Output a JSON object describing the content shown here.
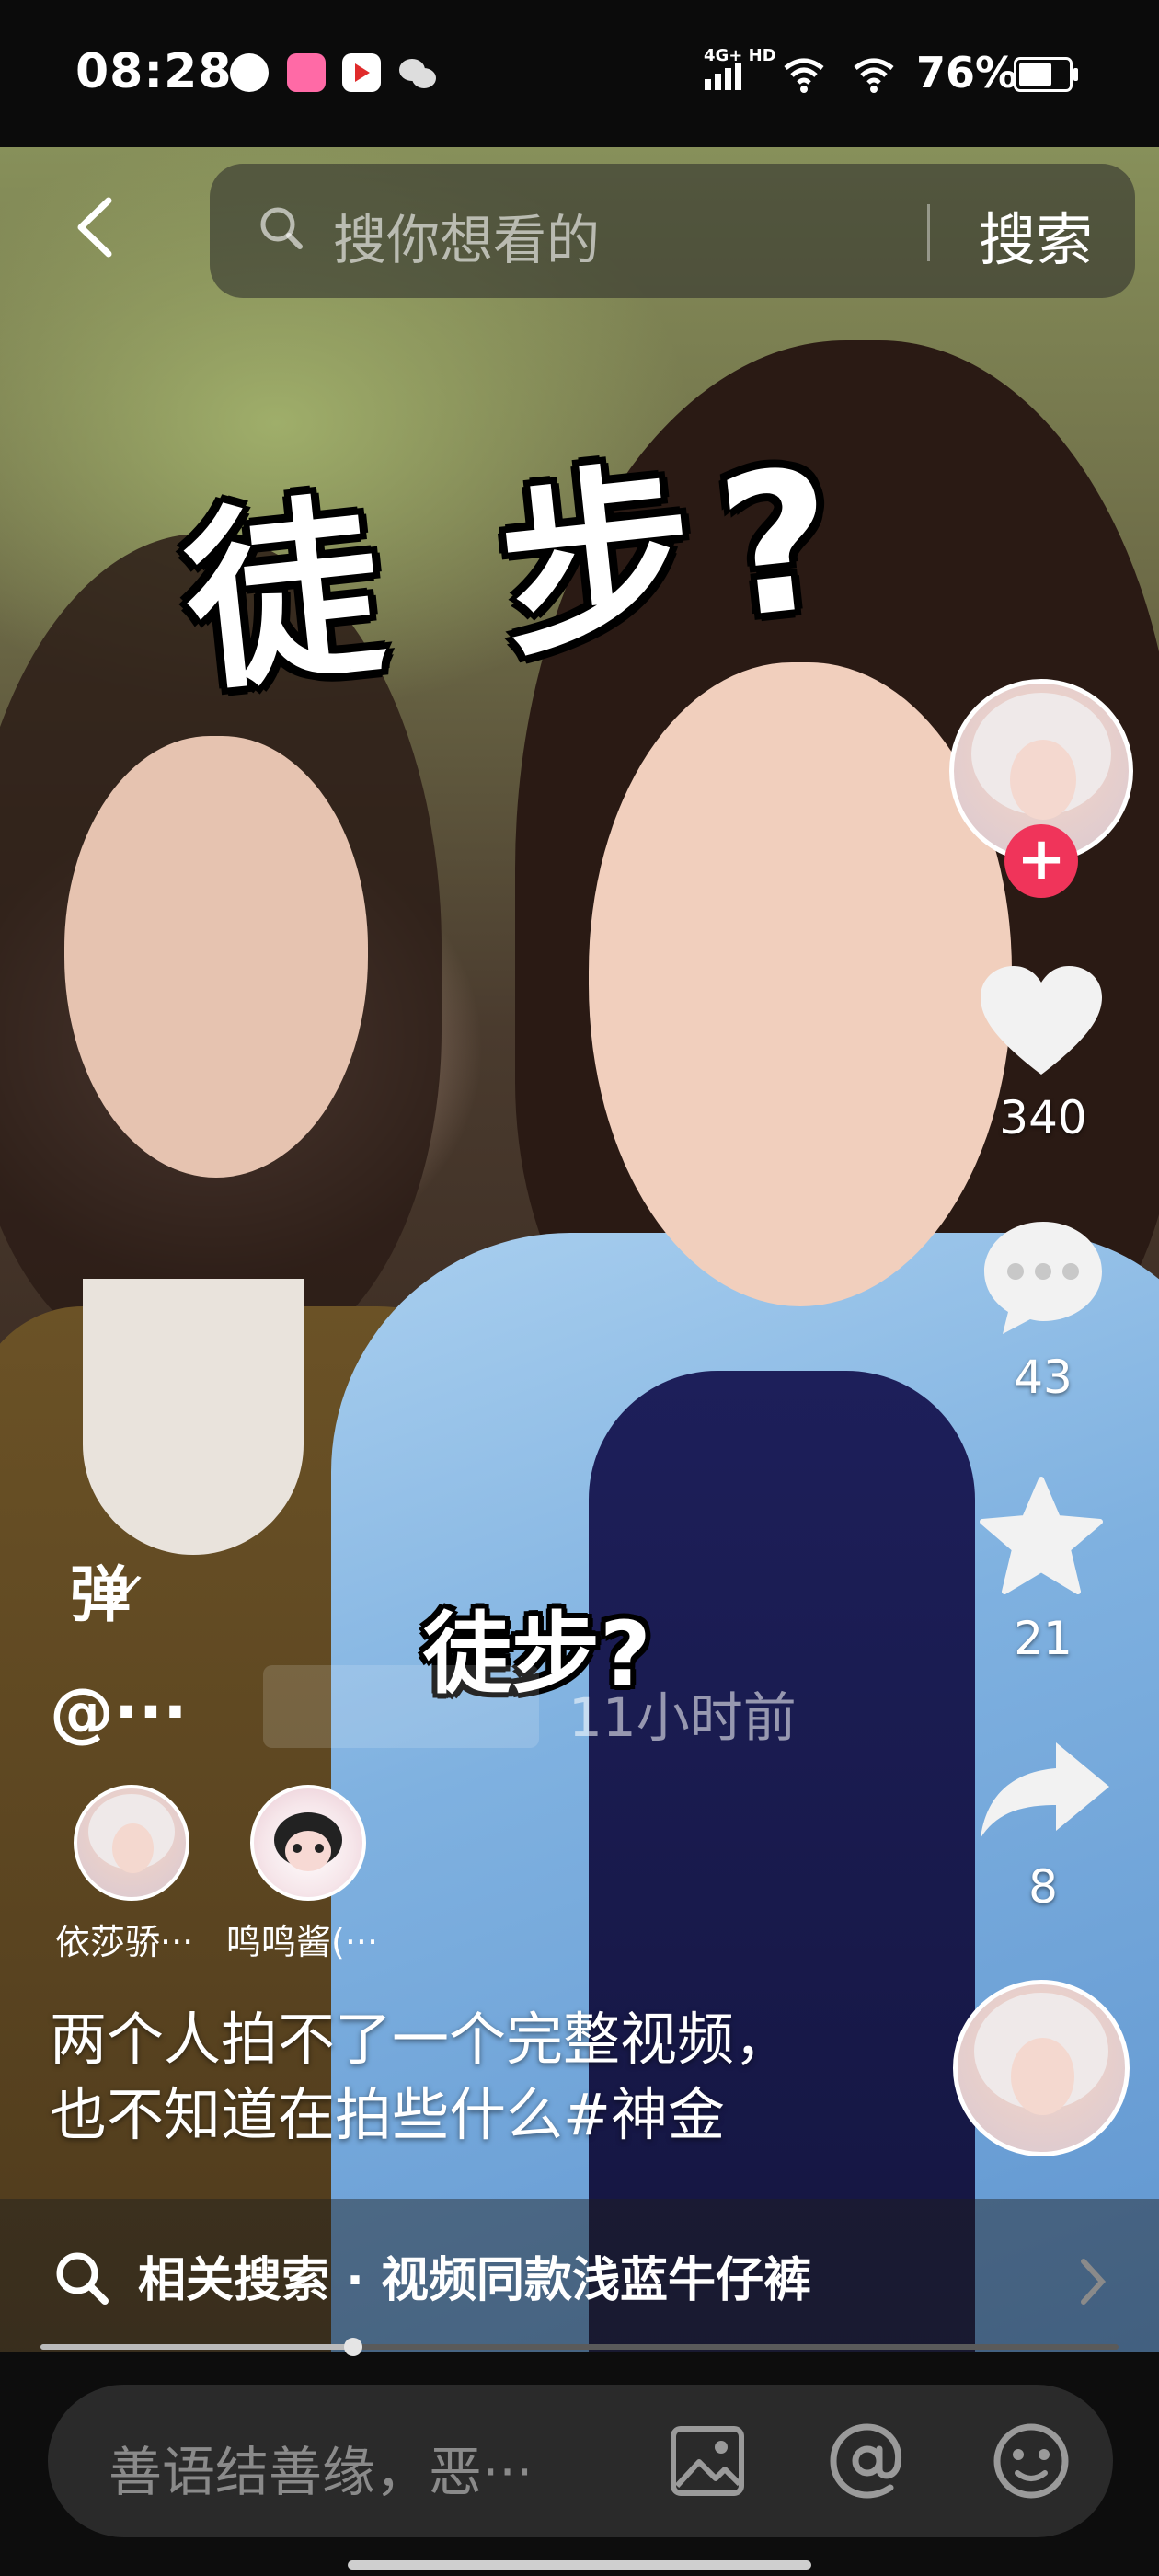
{
  "status_bar": {
    "time": "08:28",
    "network": "4G+ HD",
    "battery": "76%",
    "battery_level": 0.76,
    "notification_icons": [
      "message-icon",
      "bilibili-icon",
      "video-app-icon",
      "wechat-icon"
    ]
  },
  "video": {
    "caption_big": "徒 步?",
    "caption_small": "徒步?",
    "progress": 0.29
  },
  "search": {
    "placeholder": "搜你想看的",
    "button": "搜索"
  },
  "rail": {
    "likes": "340",
    "comments": "43",
    "favorites": "21",
    "shares": "8",
    "follow_symbol": "+"
  },
  "post": {
    "danmu_label": "弹",
    "author": "@···",
    "time_ago": "11小时前",
    "coauthors": [
      {
        "name": "依莎骄···"
      },
      {
        "name": "鸣鸣酱(···"
      }
    ],
    "description_line1": "两个人拍不了一个完整视频，",
    "description_line2": "也不知道在拍些什么#神金"
  },
  "related": {
    "text": "相关搜索 · 视频同款浅蓝牛仔裤"
  },
  "comment_bar": {
    "placeholder": "善语结善缘，恶···"
  },
  "colors": {
    "follow_red": "#f0345a",
    "background": "#000000"
  }
}
